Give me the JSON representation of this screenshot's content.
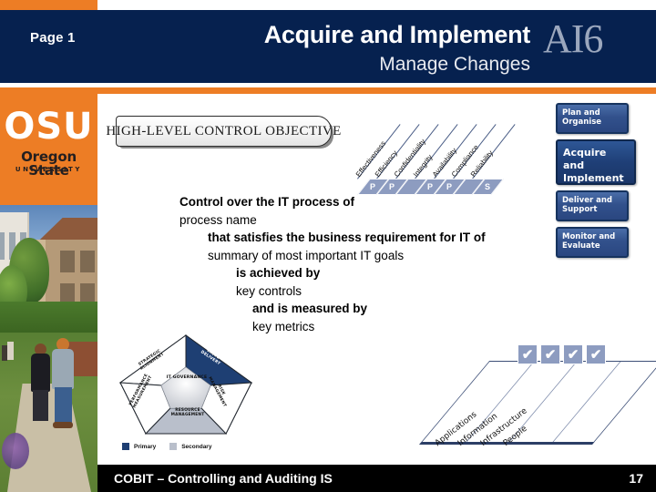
{
  "header": {
    "page_label": "Page 1",
    "title": "Acquire and Implement",
    "subtitle": "Manage Changes",
    "code": "AI6",
    "navy": "#06214F",
    "orange": "#ED7D25"
  },
  "logo": {
    "initials": "OSU",
    "name": "Oregon State",
    "word": "UNIVERSITY"
  },
  "objective_box": {
    "label_part1": "H",
    "label_part2": "IGH",
    "label_full": "HIGH-LEVEL CONTROL OBJECTIVE"
  },
  "criteria": {
    "labels": [
      "Effectiveness",
      "Efficiency",
      "Confidentiality",
      "Integrity",
      "Availability",
      "Compliance",
      "Reliability"
    ],
    "marks": [
      "P",
      "P",
      "",
      "P",
      "P",
      "",
      "S"
    ],
    "cell_color": "#8D9CC0"
  },
  "nav": {
    "items": [
      {
        "label": "Plan and Organise",
        "active": false
      },
      {
        "label": "Acquire and Implement",
        "active": true
      },
      {
        "label": "Deliver and Support",
        "active": false
      },
      {
        "label": "Monitor and Evaluate",
        "active": false
      }
    ]
  },
  "statement": {
    "l1": "Control over the IT process of",
    "l2": "process name",
    "l3": "that satisfies the business requirement for IT of",
    "l4": "summary of most important IT goals",
    "l5": "is achieved by",
    "l6": "key controls",
    "l7": "and is measured by",
    "l8": "key metrics"
  },
  "governance": {
    "core": "IT GOVERNANCE",
    "segments": [
      {
        "name": "STRATEGIC ALIGNMENT",
        "level": "none"
      },
      {
        "name": "VALUE DELIVERY",
        "level": "primary"
      },
      {
        "name": "RISK MANAGEMENT",
        "level": "none"
      },
      {
        "name": "RESOURCE MANAGEMENT",
        "level": "secondary"
      },
      {
        "name": "PERFORMANCE MEASUREMENT",
        "level": "none"
      }
    ],
    "legend": [
      {
        "label": "Primary",
        "color": "#1E3F73"
      },
      {
        "label": "Secondary",
        "color": "#B9BFCB"
      }
    ]
  },
  "resources": {
    "items": [
      {
        "label": "Applications",
        "checked": true
      },
      {
        "label": "Information",
        "checked": true
      },
      {
        "label": "Infrastructure",
        "checked": true
      },
      {
        "label": "People",
        "checked": true
      }
    ],
    "check_glyph": "✔"
  },
  "footer": {
    "text": "COBIT – Controlling and Auditing IS",
    "page_number": "17"
  }
}
